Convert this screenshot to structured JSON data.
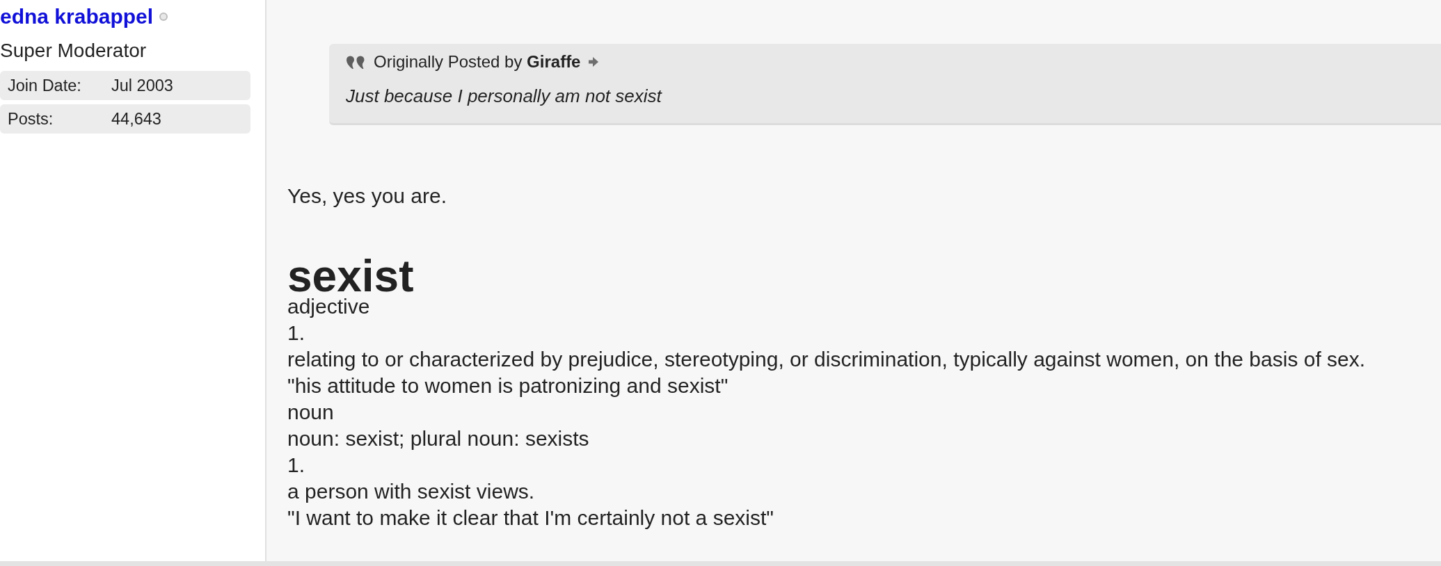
{
  "user": {
    "name": "edna krabappel",
    "online": false,
    "title": "Super Moderator",
    "details": [
      {
        "label": "Join Date:",
        "value": "Jul 2003"
      },
      {
        "label": "Posts:",
        "value": "44,643"
      }
    ]
  },
  "quote": {
    "attribution": "Originally Posted by **Giraffe**",
    "text": "Just because I personally am not sexist"
  },
  "post": {
    "reply": "Yes, yes you are.",
    "definition": {
      "headword": "sexist",
      "lines": [
        "adjective",
        "1.",
        "relating to or characterized by prejudice, stereotyping, or discrimination, typically against women, on the basis of sex.",
        "\"his attitude to women is patronizing and sexist\"",
        "noun",
        "noun: sexist; plural noun: sexists",
        "1.",
        "a person with sexist views.",
        "\"I want to make it clear that I'm certainly not a sexist\""
      ]
    }
  }
}
